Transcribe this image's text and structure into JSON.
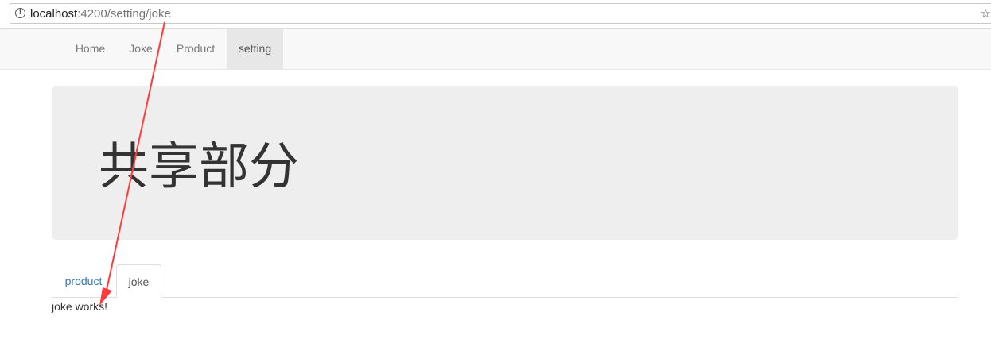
{
  "browser": {
    "url_host": "localhost",
    "url_path": ":4200/setting/joke",
    "info_icon": "info-icon",
    "bookmark_icon": "star-icon"
  },
  "navbar": {
    "items": [
      {
        "label": "Home"
      },
      {
        "label": "Joke"
      },
      {
        "label": "Product"
      },
      {
        "label": "setting",
        "active": true
      }
    ]
  },
  "jumbotron": {
    "title": "共享部分"
  },
  "tabs": {
    "items": [
      {
        "label": "product"
      },
      {
        "label": "joke",
        "active": true
      }
    ]
  },
  "content": {
    "text": "joke works!"
  },
  "colors": {
    "annotation_arrow": "#ff3b3b",
    "tab_link": "#337ab7",
    "jumbotron_bg": "#eeeeee",
    "navbar_active_bg": "#e7e7e7"
  }
}
